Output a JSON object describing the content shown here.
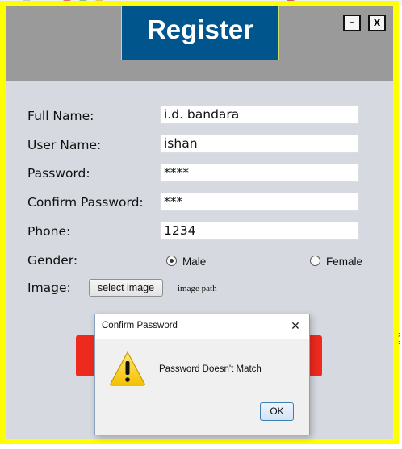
{
  "window": {
    "title": "Register",
    "minimize_label": "-",
    "close_label": "x"
  },
  "form": {
    "full_name": {
      "label": "Full Name:",
      "value": "i.d. bandara"
    },
    "user_name": {
      "label": "User Name:",
      "value": "ishan"
    },
    "password": {
      "label": "Password:",
      "value": "****"
    },
    "confirm_password": {
      "label": "Confirm Password:",
      "value": "***"
    },
    "phone": {
      "label": "Phone:",
      "value": "1234"
    },
    "gender": {
      "label": "Gender:",
      "options": [
        "Male",
        "Female"
      ],
      "selected": "Male"
    },
    "image": {
      "label": "Image:",
      "button_label": "select image",
      "path_text": "image path"
    }
  },
  "dialog": {
    "title": "Confirm Password",
    "close_label": "✕",
    "message": "Password Doesn't Match",
    "ok_label": "OK",
    "icon": "warning-icon"
  },
  "colors": {
    "frame_border": "#ffff00",
    "title_bar": "#00558d",
    "header": "#9a9a9a",
    "form_bg": "#d6d9e0",
    "action_button": "#ee2a1e"
  }
}
